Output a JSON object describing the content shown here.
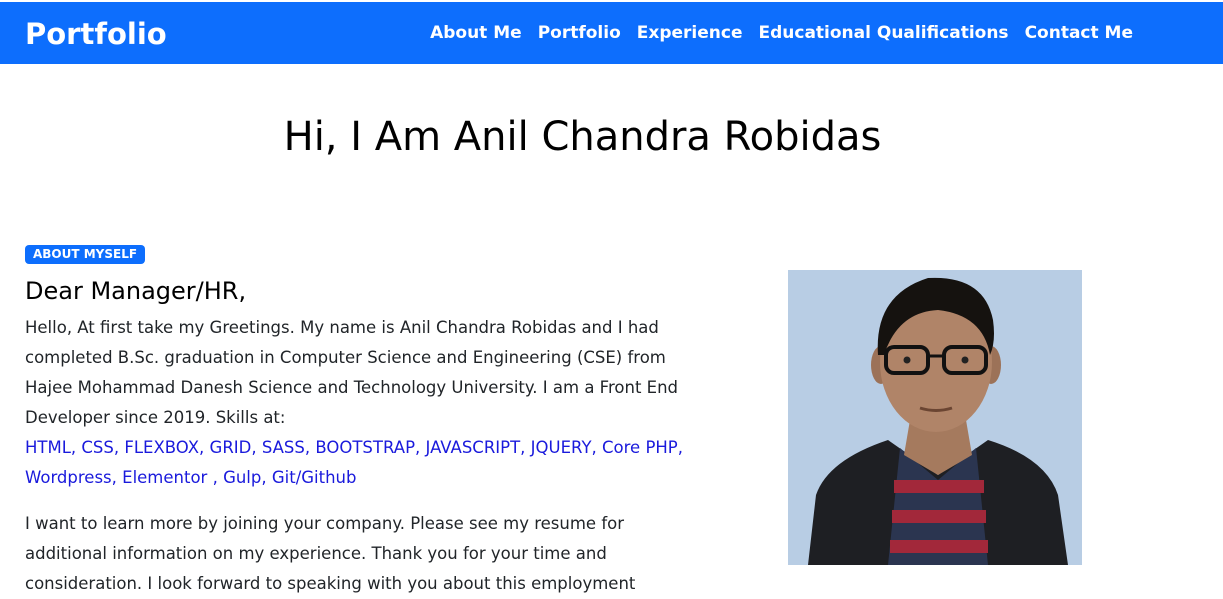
{
  "navbar": {
    "brand": "Portfolio",
    "links": [
      "About Me",
      "Portfolio",
      "Experience",
      "Educational Qualifications",
      "Contact Me"
    ]
  },
  "hero": {
    "title": "Hi, I Am Anil Chandra Robidas"
  },
  "about": {
    "badge": "ABOUT MYSELF",
    "greeting": "Dear Manager/HR,",
    "paragraph1": "Hello, At first take my Greetings. My name is Anil Chandra Robidas and I had completed B.Sc. graduation in Computer Science and Engineering (CSE) from Hajee Mohammad Danesh Science and Technology University. I am a Front End Developer since 2019. Skills at:",
    "skills": "HTML, CSS, FLEXBOX, GRID, SASS, BOOTSTRAP, JAVASCRIPT, JQUERY, Core PHP, Wordpress, Elementor , Gulp, Git/Github",
    "paragraph2": "I want to learn more by joining your company. Please see my resume for additional information on my experience. Thank you for your time and consideration. I look forward to speaking with you about this employment"
  },
  "colors": {
    "primary": "#0d6efd",
    "skills_text": "#1a1adc",
    "photo_background": "#b8cde4"
  }
}
